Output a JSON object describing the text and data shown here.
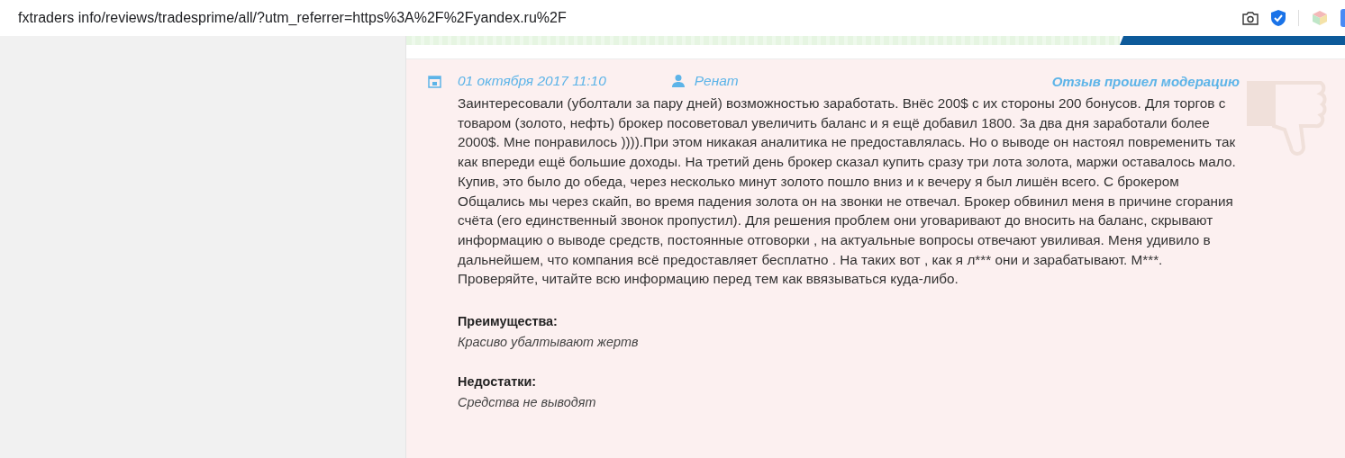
{
  "address_bar": {
    "url": "fxtraders info/reviews/tradesprime/all/?utm_referrer=https%3A%2F%2Fyandex.ru%2F"
  },
  "review": {
    "date": "01 октября 2017 11:10",
    "author": "Ренат",
    "status": "Отзыв прошел модерацию",
    "text": "Заинтересовали (уболтали за пару дней) возможностью заработать. Внёс 200$ с их стороны 200 бонусов. Для торгов с товаром (золото, нефть) брокер посоветовал увеличить баланс и я ещё добавил 1800. За два дня заработали более 2000$. Мне понравилось )))).При этом никакая аналитика не предоставлялась. Но о выводе он настоял повременить так как впереди ещё большие доходы. На третий день брокер сказал купить сразу три лота золота, маржи оставалось мало. Купив, это было до обеда, через несколько минут золото пошло вниз и к вечеру я был лишён всего. С брокером Общались мы через скайп, во время падения золота он на звонки не отвечал. Брокер обвинил меня в причине сгорания счёта (его единственный звонок пропустил). Для решения проблем они уговаривают до вносить на баланс, скрывают информацию о выводе средств, постоянные отговорки , на актуальные вопросы отвечают увиливая. Меня удивило в дальнейшем, что компания всё предоставляет бесплатно . На таких вот , как я л*** они и зарабатывают. М***. Проверяйте, читайте всю информацию перед тем как ввязываться куда-либо.",
    "sections": [
      {
        "heading": "Преимущества:",
        "body": "Красиво убалтывают жертв"
      },
      {
        "heading": "Недостатки:",
        "body": "Средства не выводят"
      }
    ]
  }
}
